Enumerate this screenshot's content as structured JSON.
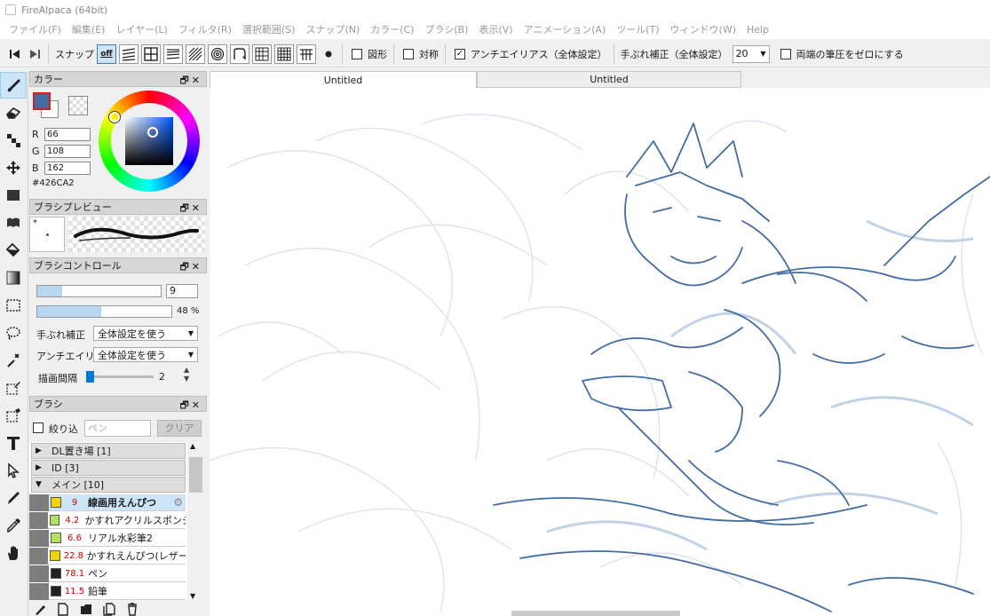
{
  "titlebar": {
    "title": "FireAlpaca (64bit)"
  },
  "menu": [
    "ファイル(F)",
    "編集(E)",
    "レイヤー(L)",
    "フィルタ(R)",
    "選択範囲(S)",
    "スナップ(N)",
    "カラー(C)",
    "ブラシ(B)",
    "表示(V)",
    "アニメーション(A)",
    "ツール(T)",
    "ウィンドウ(W)",
    "Help"
  ],
  "toolbar": {
    "snap_label": "スナップ",
    "snap_off_label": "off",
    "shape_label": "図形",
    "symmetry_label": "対称",
    "antialias_label": "アンチエイリアス（全体設定）",
    "antialias_checked": true,
    "stabilizer_label": "手ぶれ補正（全体設定）",
    "stabilizer_value": "20",
    "zero_pressure_label": "両端の筆圧をゼロにする"
  },
  "color_panel": {
    "title": "カラー",
    "r_label": "R",
    "r": "66",
    "g_label": "G",
    "g": "108",
    "b_label": "B",
    "b": "162",
    "hex": "#426CA2",
    "primary_color": "#426CA2"
  },
  "brush_preview": {
    "title": "ブラシプレビュー",
    "mark": "*"
  },
  "brush_control": {
    "title": "ブラシコントロール",
    "size": "9",
    "size_fraction": 0.2,
    "opacity": "48 %",
    "opacity_fraction": 0.48,
    "stabilizer_label": "手ぶれ補正",
    "stabilizer_value": "全体設定を使う",
    "antialias_label": "アンチエイリア",
    "antialias_value": "全体設定を使う",
    "interval_label": "描画間隔",
    "interval_value": "2"
  },
  "brush_panel": {
    "title": "ブラシ",
    "filter_label": "絞り込",
    "filter_placeholder": "ペン",
    "clear_label": "クリア",
    "categories": [
      {
        "label": "DL置き場 [1]",
        "arrow": "▶"
      },
      {
        "label": "ID [3]",
        "arrow": "▶"
      },
      {
        "label": "メイン [10]",
        "arrow": "▼"
      }
    ],
    "brushes": [
      {
        "size": "9",
        "name": "線画用えんぴつ",
        "color": "#f2d400",
        "selected": true
      },
      {
        "size": "4.2",
        "name": "かすれアクリルスポンジ",
        "color": "#b8e060",
        "selected": false
      },
      {
        "size": "6.6",
        "name": "リアル水彩筆2",
        "color": "#b8e060",
        "selected": false
      },
      {
        "size": "22.8",
        "name": "かすれえんぴつ(レザー",
        "color": "#f2d400",
        "selected": false
      },
      {
        "size": "78.1",
        "name": "ペン",
        "color": "#222222",
        "selected": false
      },
      {
        "size": "11.5",
        "name": "鉛筆",
        "color": "#222222",
        "selected": false
      }
    ]
  },
  "tabs": [
    {
      "label": "Untitled",
      "active": true
    },
    {
      "label": "Untitled",
      "active": false
    }
  ]
}
